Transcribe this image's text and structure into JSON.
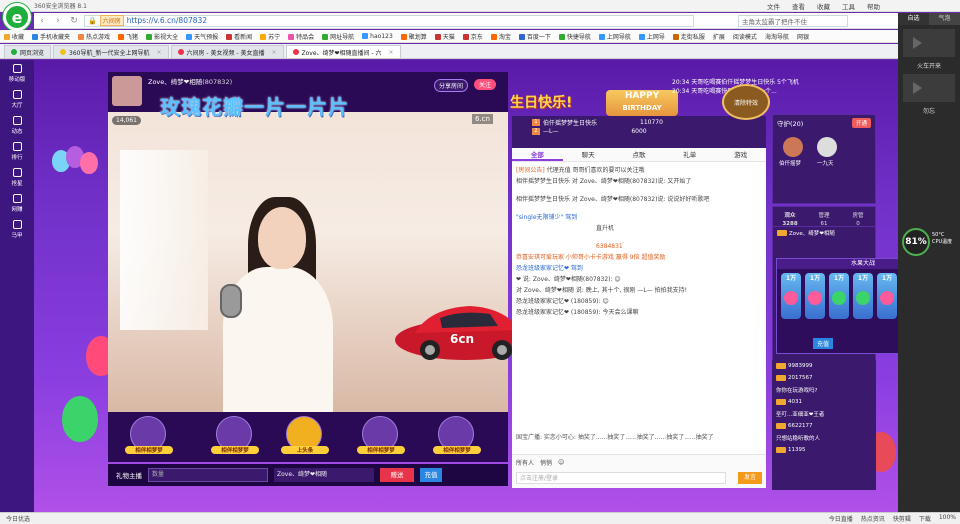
{
  "window": {
    "title": "360安全浏览器 8.1"
  },
  "menu": [
    "文件",
    "查看",
    "收藏",
    "工具",
    "帮助"
  ],
  "address": {
    "site_tag": "六间房",
    "url": "https://v.6.cn/807832",
    "search_placeholder": "主角太监霸了把件不住"
  },
  "bookmarks": [
    "收藏",
    "手机收藏夹",
    "热点游戏",
    "飞猪",
    "影视大全",
    "天气预报",
    "看新闻",
    "苏宁",
    "特品会",
    "网址导航",
    "hao123",
    "聚划算",
    "天猫",
    "京东",
    "淘宝",
    "百度一下",
    "快捷导航",
    "上网导航",
    "上网导",
    "走街私服"
  ],
  "bookmark_tools": [
    "扩展",
    "阅读模式",
    "海淘导航",
    "网银"
  ],
  "tabs": [
    {
      "label": "网页浏览",
      "active": false
    },
    {
      "label": "360导航_新一代安全上网导航",
      "active": false
    },
    {
      "label": "六间房 - 美女视频 - 美女直播",
      "active": false
    },
    {
      "label": "Zove、绮梦❤相随直播间 - 六",
      "active": true
    }
  ],
  "left_nav": [
    "移动版",
    "大厅",
    "动态",
    "排行",
    "抢星",
    "网赚",
    "马甲"
  ],
  "anchor": {
    "name": "Zove、绮梦❤相随",
    "id": "(807832)",
    "viewers": "14,061",
    "share": "分享房间",
    "follow": "关注",
    "brand": "6.cn"
  },
  "banner": {
    "text": "玫瑰花瓣一片一片片",
    "birthday": "生日快乐!",
    "happy": "HAPPY",
    "birthday_en": "BIRTHDAY"
  },
  "gifts": [
    "相伴相梦梦",
    "相伴相梦梦",
    "上头条",
    "相伴相梦梦",
    "相伴相梦梦"
  ],
  "bottom_bar": {
    "gift_main": "礼物主播",
    "qty_placeholder": "数量",
    "target": "Zove、绮梦❤相随",
    "send": "赠送",
    "charge": "充值"
  },
  "chat": {
    "tabs": [
      "全部",
      "聊天",
      "点歌",
      "礼单",
      "游戏"
    ],
    "rank": [
      {
        "n": "1",
        "name": "伯仟摇梦梦生日快乐",
        "v": "110770"
      },
      {
        "n": "2",
        "name": "—L—",
        "v": "6000"
      }
    ],
    "messages": [
      {
        "pre": "[房间公告]",
        "text": "代理充值 哥哥们喜欢的要可以关注哦"
      },
      {
        "pre": "",
        "text": "相伴摇梦梦生日快乐 对 Zove、绮梦❤相随(807832)说: 又开始了"
      },
      {
        "pre": "",
        "text": "相伴摇梦梦生日快乐 对 Zove、绮梦❤相随(807832)说: 说说好好听歌吧"
      },
      {
        "pre": "",
        "text": "\"single无限铺少\" 驾到"
      },
      {
        "pre": "",
        "text": "直升机"
      },
      {
        "pre": "",
        "text": "6384831"
      },
      {
        "pre": "",
        "text": "恭喜安琪可爱玩家 小帅哥小卡卡游戏 赢得 9倍 超值奖励"
      },
      {
        "pre": "",
        "text": "恐龙班级家家记忆❤ 驾到"
      },
      {
        "pre": "",
        "text": "❤ 说: Zove、绮梦❤相随(807832): 😊"
      },
      {
        "pre": "",
        "text": "对 Zove、绮梦❤相随 说: 晚上, 其十个, 很刚 —L— 拍拍我支持!"
      },
      {
        "pre": "",
        "text": "恐龙班级家家记忆❤ (180859): 😊"
      },
      {
        "pre": "",
        "text": "恐龙班级家家记忆❤ (180859): 今天会么课嘛"
      }
    ],
    "marquee": "国宝广播: 实恋小可心: 抽奖了......抽奖了......抽奖了......抽奖了......抽奖了",
    "filter_all": "所有人",
    "private": "悄悄",
    "input_placeholder": "点击注册/登录",
    "send": "发言"
  },
  "guard": {
    "title": "守护",
    "count": "(20)",
    "btn": "开通",
    "members": [
      "伯仟摇梦",
      "一九天"
    ]
  },
  "audience": {
    "tabs": [
      {
        "label": "观众",
        "n": "3288"
      },
      {
        "label": "管理",
        "n": "61"
      },
      {
        "label": "房管",
        "n": "0"
      }
    ],
    "rows": [
      "Zove、绮梦❤相随",
      "9983999",
      "2017567",
      "你你在玩游戏吗?",
      "4031",
      "圣叮...亚细亚❤王者",
      "6622177",
      "只想站稳听歌的人",
      "11395"
    ]
  },
  "game": {
    "title": "水果大战",
    "multipliers": [
      "1万",
      "1万",
      "1万",
      "1万",
      "1万",
      "1万"
    ],
    "button": "充值"
  },
  "ticker": [
    "20:34 天哥吃喝赛伯仟摇梦梦生日快乐 5个飞机",
    "20:34 天哥吃喝赛快到三方开心 一个..."
  ],
  "right_sidebar": {
    "tabs": [
      "自选",
      "气泡"
    ],
    "labels": [
      "火车开来",
      "勿忘"
    ]
  },
  "cpu": {
    "value": "81%",
    "temp": "50°C",
    "label": "CPU温度"
  },
  "status": {
    "left": "今日优选",
    "right": [
      "今日直播",
      "热点资讯",
      "快剪辑",
      "下载",
      "100%"
    ]
  },
  "colors": {
    "accent": "#8a3ee0",
    "follow": "#ff4f7b",
    "brand_green": "#1fae3b"
  }
}
